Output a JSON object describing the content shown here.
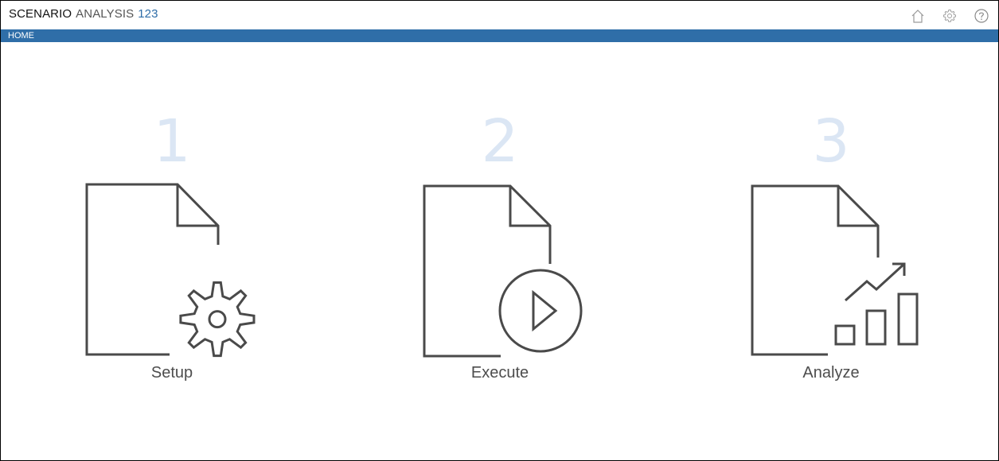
{
  "header": {
    "title_part1": "SCENARIO",
    "title_part2": "ANALYSIS",
    "title_part3": "123",
    "icons": [
      "home-icon",
      "gear-icon",
      "help-icon"
    ]
  },
  "nav": {
    "items": [
      {
        "label": "HOME"
      }
    ]
  },
  "steps": [
    {
      "number": "1",
      "label": "Setup",
      "icon": "document-gear-icon"
    },
    {
      "number": "2",
      "label": "Execute",
      "icon": "document-play-icon"
    },
    {
      "number": "3",
      "label": "Analyze",
      "icon": "document-chart-icon"
    }
  ],
  "colors": {
    "accent": "#2f6ea8",
    "step_number": "#dbe6f4",
    "icon_stroke": "#4a4a4a",
    "label": "#4d4d4d"
  }
}
